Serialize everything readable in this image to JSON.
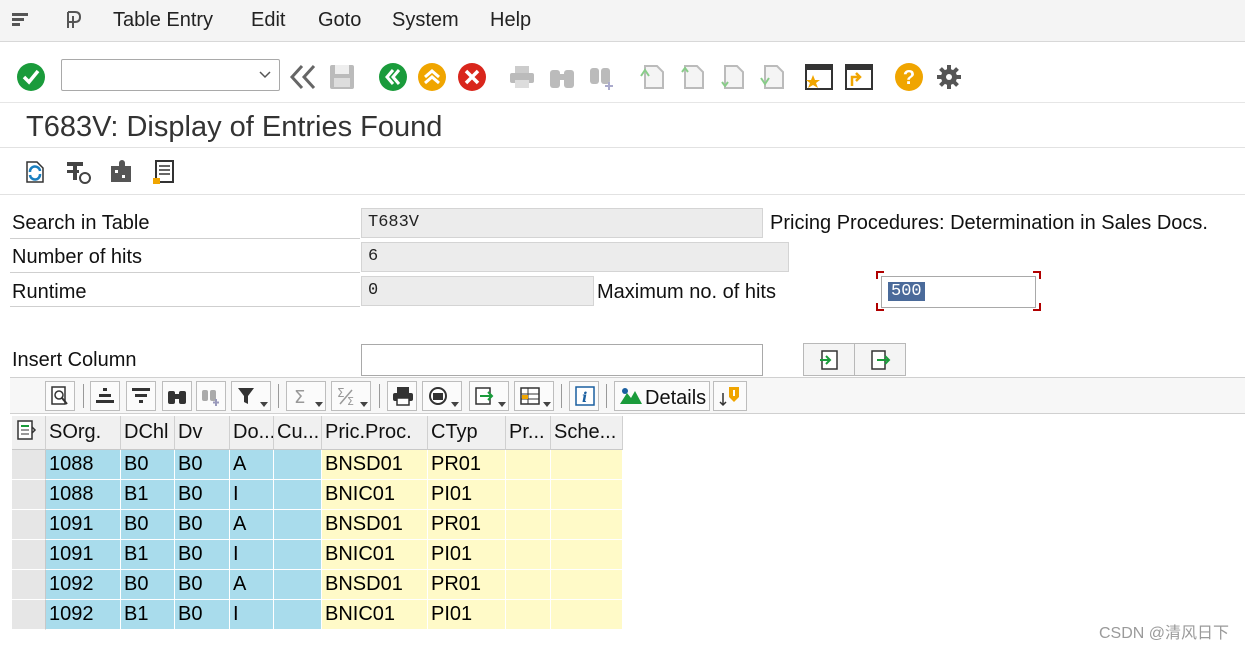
{
  "menu": {
    "items": [
      "Table Entry",
      "Edit",
      "Goto",
      "System",
      "Help"
    ]
  },
  "toolbar": {
    "command_field_value": "",
    "icons": [
      "enter-check-icon",
      "back-nav-icon",
      "save-icon",
      "back-icon",
      "exit-icon",
      "cancel-icon",
      "print-icon",
      "find-icon",
      "find-next-icon",
      "first-page-icon",
      "previous-page-icon",
      "next-page-icon",
      "last-page-icon",
      "bookmark-icon",
      "create-session-icon",
      "help-icon",
      "settings-gear-icon"
    ]
  },
  "page": {
    "title": "T683V: Display of Entries Found"
  },
  "form": {
    "search_in_table_label": "Search in Table",
    "search_in_table_value": "T683V",
    "table_description": "Pricing Procedures: Determination in Sales Docs.",
    "number_of_hits_label": "Number of hits",
    "number_of_hits_value": "6",
    "runtime_label": "Runtime",
    "runtime_value": "0",
    "max_hits_label": "Maximum no. of hits",
    "max_hits_value": "500",
    "insert_column_label": "Insert Column",
    "insert_column_value": ""
  },
  "alv": {
    "details_label": "Details"
  },
  "grid": {
    "columns": [
      "SOrg.",
      "DChl",
      "Dv",
      "Do...",
      "Cu...",
      "Pric.Proc.",
      "CTyp",
      "Pr...",
      "Sche..."
    ],
    "rows": [
      [
        "1088",
        "B0",
        "B0",
        "A",
        "",
        "BNSD01",
        "PR01",
        "",
        ""
      ],
      [
        "1088",
        "B1",
        "B0",
        "I",
        "",
        "BNIC01",
        "PI01",
        "",
        ""
      ],
      [
        "1091",
        "B0",
        "B0",
        "A",
        "",
        "BNSD01",
        "PR01",
        "",
        ""
      ],
      [
        "1091",
        "B1",
        "B0",
        "I",
        "",
        "BNIC01",
        "PI01",
        "",
        ""
      ],
      [
        "1092",
        "B0",
        "B0",
        "A",
        "",
        "BNSD01",
        "PR01",
        "",
        ""
      ],
      [
        "1092",
        "B1",
        "B0",
        "I",
        "",
        "BNIC01",
        "PI01",
        "",
        ""
      ]
    ]
  },
  "colors": {
    "key_column_bg": "#a9dcec",
    "data_column_bg": "#fffac8",
    "accent_green": "#1a9b3b",
    "accent_orange": "#f0a500",
    "accent_red": "#d9261c"
  },
  "watermark": "CSDN @清风日下"
}
